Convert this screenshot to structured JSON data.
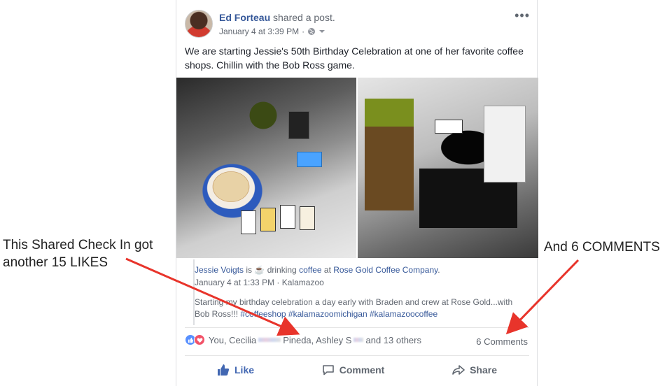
{
  "post": {
    "author": "Ed Forteau",
    "action": "shared a post.",
    "date": "January 4 at 3:39 PM",
    "separator": "·",
    "more": "•••",
    "text": "We are starting Jessie's 50th Birthday Celebration at one of her favorite coffee shops. Chillin with the Bob Ross game."
  },
  "checkin": {
    "user": "Jessie Voigts",
    "is": "is",
    "activity_icon": "☕",
    "activity": "drinking",
    "object": "coffee",
    "at": "at",
    "place": "Rose Gold Coffee Company",
    "period": ".",
    "time": "January 4 at 1:33 PM",
    "dot": "·",
    "location": "Kalamazoo",
    "body_text": "Starting my birthday celebration a day early with Braden and crew at Rose Gold...with Bob Ross!!! ",
    "hashtags": [
      "#coffeeshop",
      "#kalamazoomichigan",
      "#kalamazoocoffee"
    ]
  },
  "reactions": {
    "names_1": "You, Cecilia ",
    "names_2": " Pineda, Ashley S",
    "names_3": "and 13 others",
    "comments": "6 Comments"
  },
  "actions": {
    "like": "Like",
    "comment": "Comment",
    "share": "Share"
  },
  "annotations": {
    "left_line1": "This Shared Check In got",
    "left_line2": "another 15 LIKES",
    "right": "And 6 COMMENTS"
  },
  "colors": {
    "link": "#365899",
    "like_blue": "#4267b2",
    "arrow_red": "#e8342b",
    "muted": "#616770"
  }
}
